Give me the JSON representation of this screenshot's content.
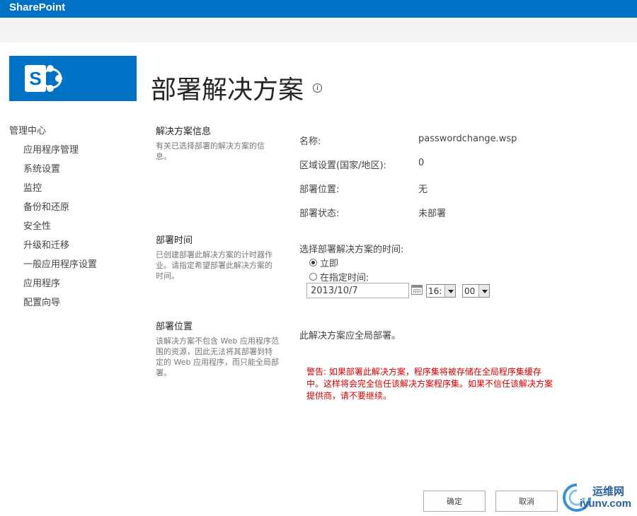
{
  "suite_bar": {
    "brand": "SharePoint",
    "color": "#0072c6"
  },
  "logo": {
    "letter": "S",
    "icon": "sharepoint-logo-icon"
  },
  "page_title": "部署解决方案",
  "title_info_icon": "info-icon",
  "quick_launch": {
    "heading": "管理中心",
    "items": [
      "应用程序管理",
      "系统设置",
      "监控",
      "备份和还原",
      "安全性",
      "升级和迁移",
      "一般应用程序设置",
      "应用程序",
      "配置向导"
    ]
  },
  "sections": {
    "solution_info": {
      "title": "解决方案信息",
      "description": "有关已选择部署的解决方案的信息。"
    },
    "deploy_time": {
      "title": "部署时间",
      "description": "已创建部署此解决方案的计时器作业。请指定希望部署此解决方案的时间。"
    },
    "deploy_location": {
      "title": "部署位置",
      "description": "该解决方案不包含 Web 应用程序范围的资源，因此无法将其部署到特定的 Web 应用程序，而只能全局部署。"
    }
  },
  "properties": [
    {
      "label": "名称:",
      "value": "passwordchange.wsp"
    },
    {
      "label": "区域设置(国家/地区):",
      "value": "0"
    },
    {
      "label": "部署位置:",
      "value": "无"
    },
    {
      "label": "部署状态:",
      "value": "未部署"
    }
  ],
  "schedule": {
    "label": "选择部署解决方案的时间:",
    "option_now": "立即",
    "option_specified": "在指定时间:",
    "selected": "立即",
    "date": "2013/10/7",
    "hour": "16:",
    "minute": "00"
  },
  "deploy_location_text": "此解决方案应全局部署。",
  "warning": {
    "text": "警告: 如果部署此解决方案，程序集将被存储在全局程序集缓存中。这样将会完全信任该解决方案程序集。如果不信任该解决方案提供商，请不要继续。",
    "color": "#cc0000"
  },
  "buttons": {
    "ok": "确定",
    "cancel": "取消"
  },
  "watermark": {
    "cn": "运维网",
    "en": "iyunv.com"
  }
}
